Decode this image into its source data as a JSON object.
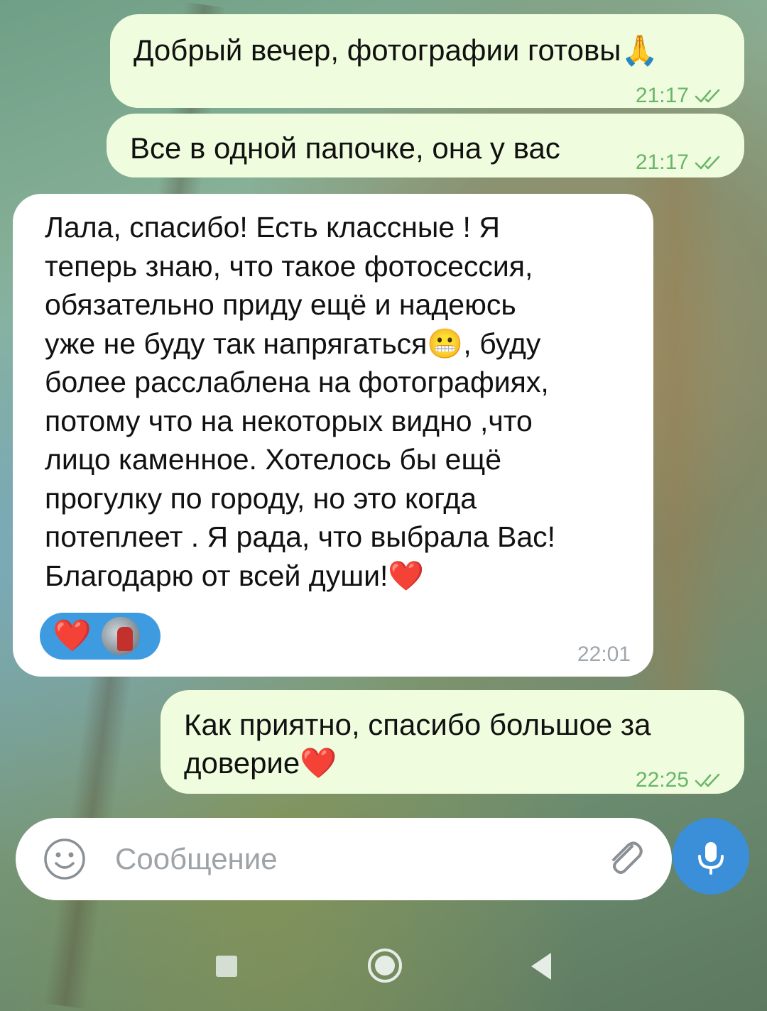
{
  "messages": [
    {
      "direction": "outgoing",
      "text": "Добрый вечер, фотографии готовы🙏",
      "time": "21:17",
      "status": "read"
    },
    {
      "direction": "outgoing",
      "text": "Все в одной папочке, она у вас",
      "time": "21:17",
      "status": "read"
    },
    {
      "direction": "incoming",
      "text": "Лала, спасибо! Есть классные ! Я\nтеперь знаю, что такое фотосессия,\nобязательно приду ещё и надеюсь\nуже не буду так напрягаться😬, буду\nболее расслаблена на фотографиях,\nпотому что на некоторых видно ,что\nлицо каменное. Хотелось бы ещё\nпрогулку по городу, но это когда\nпотеплеет . Я рада, что выбрала Вас!\nБлагодарю от всей души!❤️",
      "time": "22:01",
      "reaction": "❤️"
    },
    {
      "direction": "outgoing",
      "text": "Как приятно, спасибо большое за\nдоверие❤️",
      "time": "22:25",
      "status": "read"
    }
  ],
  "composer": {
    "placeholder": "Сообщение"
  },
  "colors": {
    "outgoing_bubble": "#effdde",
    "incoming_bubble": "#ffffff",
    "accent": "#3a8fd8",
    "read_ticks": "#6ab56a"
  }
}
